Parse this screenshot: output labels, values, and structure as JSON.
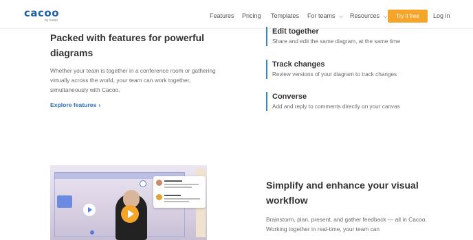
{
  "header": {
    "logo_text": "cacoo",
    "logo_sub": "by nulab",
    "nav": [
      {
        "label": "Features"
      },
      {
        "label": "Pricing"
      },
      {
        "label": "Templates"
      },
      {
        "label": "For teams"
      },
      {
        "label": "Resources"
      }
    ],
    "try_button": "Try it free",
    "login": "Log in"
  },
  "feature": {
    "title": "Packed with features for powerful diagrams",
    "description": "Whether your team is together in a conference room or gathering virtually across the world, your team can work together, simultaneously with Cacoo.",
    "link": "Explore features"
  },
  "items": [
    {
      "title": "Edit together",
      "desc": "Share and edit the same diagram, at the same time"
    },
    {
      "title": "Track changes",
      "desc": "Review versions of your diagram to track changes"
    },
    {
      "title": "Converse",
      "desc": "Add and reply to comments directly on your canvas"
    }
  ],
  "simplify": {
    "title": "Simplify and enhance your visual workflow",
    "description": "Brainstorm, plan, present, and gather feedback — all in Cacoo. Working together in real-time, your team can"
  },
  "colors": {
    "brand_blue": "#1f5fa8",
    "accent_orange": "#f4a52a",
    "link_blue": "#2e6db5",
    "item_border": "#2e8bc9"
  },
  "icons": {
    "nav_dropdown": "chevron-down-icon",
    "explore_arrow": "chevron-right-icon",
    "video_play": "play-icon"
  }
}
